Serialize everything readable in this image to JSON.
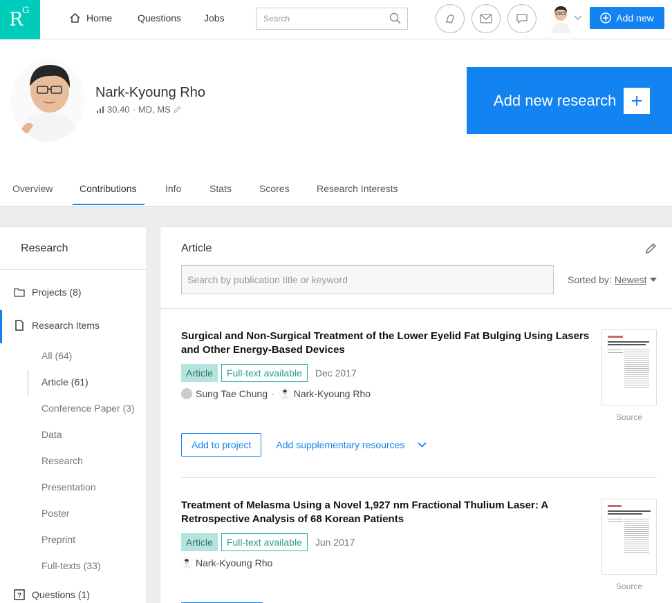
{
  "nav": {
    "logo_r": "R",
    "logo_g": "G",
    "home": "Home",
    "questions": "Questions",
    "jobs": "Jobs",
    "search_placeholder": "Search",
    "add_new": "Add new"
  },
  "profile": {
    "name": "Nark-Kyoung Rho",
    "score": "30.40",
    "degree": "MD, MS",
    "add_research": "Add new research"
  },
  "tabs": [
    "Overview",
    "Contributions",
    "Info",
    "Stats",
    "Scores",
    "Research Interests"
  ],
  "active_tab": "Contributions",
  "left_panel": {
    "title": "Research",
    "projects": "Projects (8)",
    "research_items": "Research Items",
    "sub_items": [
      "All (64)",
      "Article (61)",
      "Conference Paper (3)",
      "Data",
      "Research",
      "Presentation",
      "Poster",
      "Preprint",
      "Full-texts (33)"
    ],
    "selected_sub": "Article (61)",
    "questions": "Questions (1)"
  },
  "main_panel": {
    "title": "Article",
    "search_placeholder": "Search by publication title or keyword",
    "sorted_label": "Sorted by:",
    "sorted_value": "Newest"
  },
  "publications": [
    {
      "title": "Surgical and Non-Surgical Treatment of the Lower Eyelid Fat Bulging Using Lasers and Other Energy-Based Devices",
      "type": "Article",
      "fulltext": "Full-text available",
      "date": "Dec 2017",
      "authors": [
        "Sung Tae Chung",
        "Nark-Kyoung Rho"
      ],
      "source": "Source",
      "add_project": "Add to project",
      "supplementary": "Add supplementary resources"
    },
    {
      "title": "Treatment of Melasma Using a Novel 1,927 nm Fractional Thulium Laser: A Retrospective Analysis of 68 Korean Patients",
      "type": "Article",
      "fulltext": "Full-text available",
      "date": "Jun 2017",
      "authors": [
        "Nark-Kyoung Rho"
      ],
      "source": "Source"
    }
  ],
  "colors": {
    "brand_teal": "#00ccbb",
    "primary_blue": "#1283f0",
    "badge_bg": "#b4e4de",
    "badge_border": "#2bb2a3"
  }
}
